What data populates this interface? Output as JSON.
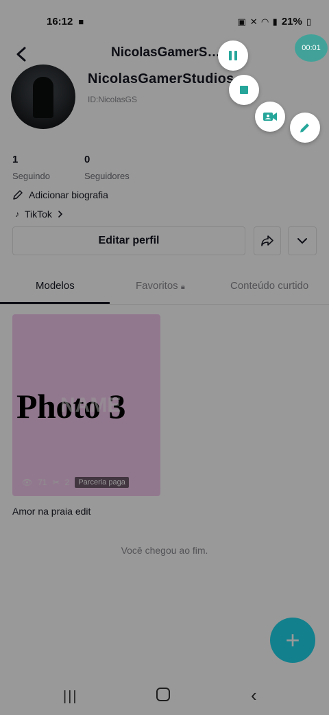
{
  "status_bar": {
    "time": "16:12",
    "battery": "21%"
  },
  "header": {
    "title": "NicolasGamerSt..."
  },
  "profile": {
    "display_name": "NicolasGamerStudios",
    "username": "ID:NicolasGS"
  },
  "stats": [
    {
      "value": "1",
      "label": "Seguindo"
    },
    {
      "value": "0",
      "label": "Seguidores"
    }
  ],
  "bio": {
    "add_bio_label": "Adicionar biografia",
    "tiktok_link_label": "TikTok"
  },
  "actions": {
    "edit_profile_label": "Editar perfil"
  },
  "tabs": [
    {
      "label": "Modelos",
      "active": true
    },
    {
      "label": "Favoritos",
      "active": false
    },
    {
      "label": "Conteúdo curtido",
      "active": false
    }
  ],
  "template_card": {
    "thumbnail_text": "Photo 3",
    "overlay_text": "NAME",
    "views": "71",
    "clips": "2",
    "badge": "Parceria paga",
    "caption": "Amor na praia edit"
  },
  "end_message": "Você chegou ao fim.",
  "screen_recorder": {
    "timer": "00:01",
    "accent_color": "#26a69a"
  },
  "colors": {
    "fab": "#20d5ec",
    "card_bg": "#f3c9ef"
  }
}
